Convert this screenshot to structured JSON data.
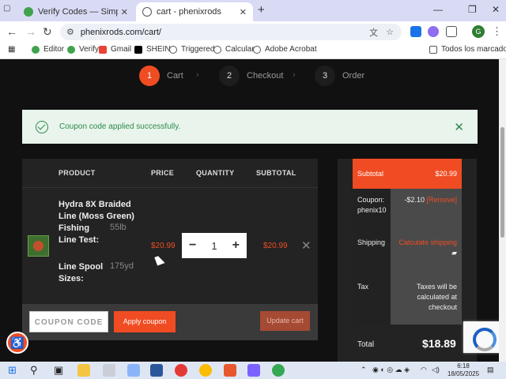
{
  "browser": {
    "tabs": [
      {
        "title": "Verify Codes — SimplyCodes",
        "active": false
      },
      {
        "title": "cart - phenixrods",
        "active": true
      }
    ],
    "url": "phenixrods.com/cart/",
    "bookmarks": [
      "Editor",
      "Verify",
      "Gmail",
      "SHEIN",
      "Triggered",
      "Calcular",
      "Adobe Acrobat"
    ],
    "all_bookmarks": "Todos los marcadores",
    "avatar_initial": "G"
  },
  "steps": [
    {
      "num": "1",
      "label": "Cart"
    },
    {
      "num": "2",
      "label": "Checkout"
    },
    {
      "num": "3",
      "label": "Order"
    }
  ],
  "notice": {
    "message": "Coupon code applied successfully."
  },
  "cart": {
    "headers": {
      "product": "PRODUCT",
      "price": "PRICE",
      "quantity": "QUANTITY",
      "subtotal": "SUBTOTAL"
    },
    "item": {
      "name": "Hydra 8X Braided Line (Moss Green)",
      "attr1_label": "Fishing Line Test:",
      "attr1_value": "55lb",
      "attr2_label": "Line Spool Sizes:",
      "attr2_value": "175yd",
      "price": "$20.99",
      "quantity": "1",
      "subtotal": "$20.99"
    },
    "coupon_placeholder": "COUPON CODE",
    "apply_label": "Apply coupon",
    "update_label": "Update cart"
  },
  "summary": {
    "subtotal_label": "Subtotal",
    "subtotal_value": "$20.99",
    "coupon_label_1": "Coupon:",
    "coupon_label_2": "phenix10",
    "coupon_value": "-$2.10",
    "coupon_remove": "[Remove]",
    "shipping_label": "Shipping",
    "shipping_value": "Calculate shipping",
    "tax_label": "Tax",
    "tax_value": "Taxes will be calculated at checkout",
    "total_label": "Total",
    "total_value": "$18.89"
  },
  "taskbar": {
    "time": "6:18",
    "date": "18/05/2025"
  },
  "colors": {
    "accent": "#f04c23",
    "success": "#2f8a4a"
  }
}
